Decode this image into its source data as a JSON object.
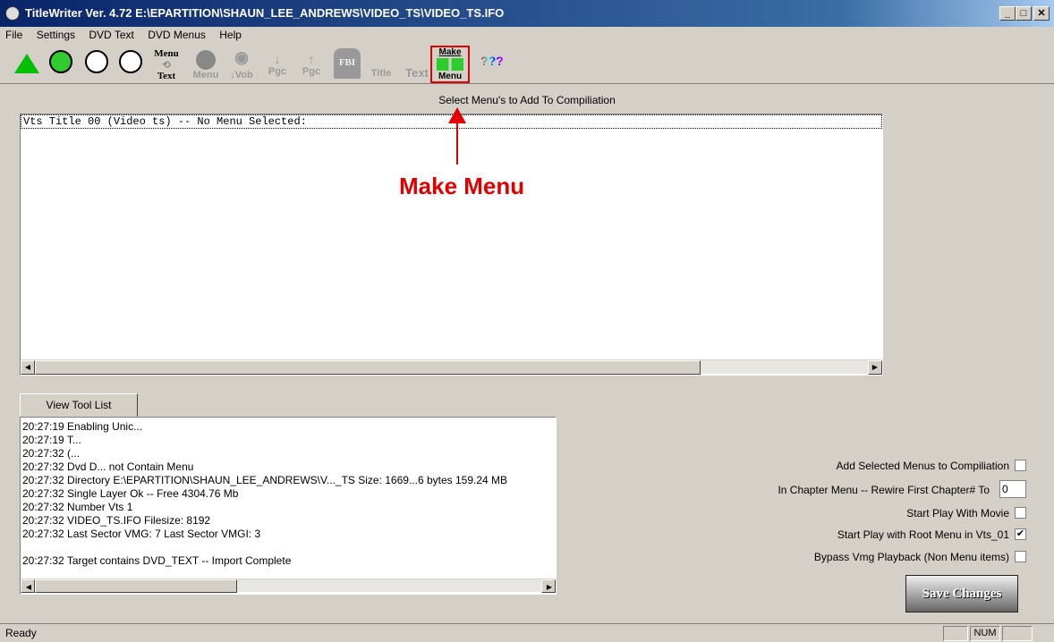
{
  "window": {
    "title": "TitleWriter Ver. 4.72  E:\\EPARTITION\\SHAUN_LEE_ANDREWS\\VIDEO_TS\\VIDEO_TS.IFO",
    "min": "_",
    "max": "□",
    "close": "✕"
  },
  "menu": [
    "File",
    "Settings",
    "DVD Text",
    "DVD Menus",
    "Help"
  ],
  "toolbar": {
    "menu_text_top": "Menu",
    "menu_text_bottom": "Text",
    "menu": "Menu",
    "vob": "↓Vob",
    "pgc_down": "Pgc",
    "pgc_up": "Pgc",
    "fbi": "FBI",
    "title": "Title",
    "text": "Text",
    "make": "Make",
    "make_menu": "Menu",
    "help": "???"
  },
  "main": {
    "list_label": "Select Menu's to Add To Compiliation",
    "list_items": [
      "Vts Title 00 (Video ts) -- No Menu Selected:"
    ]
  },
  "annotation": {
    "label": "Make Menu",
    "color": "#e00000"
  },
  "tool_tab": "View Tool List",
  "log": [
    "20:27:19 Enabling Unic...",
    "20:27:19 T...",
    "20:27:32 (...",
    "20:27:32 Dvd D... not Contain Menu",
    "20:27:32 Directory E:\\EPARTITION\\SHAUN_LEE_ANDREWS\\V..._TS Size: 1669...6 bytes  159.24 MB",
    "20:27:32 Single Layer Ok -- Free  4304.76 Mb",
    "20:27:32 Number Vts 1",
    "20:27:32 VIDEO_TS.IFO Filesize: 8192",
    "20:27:32 Last Sector VMG: 7   Last Sector VMGI: 3",
    "",
    "20:27:32 Target contains DVD_TEXT -- Import Complete"
  ],
  "options": {
    "add_selected": {
      "label": "Add Selected Menus to Compiliation",
      "checked": false
    },
    "rewire": {
      "label": "In Chapter Menu -- Rewire First Chapter#  To",
      "value": "0"
    },
    "start_movie": {
      "label": "Start Play With Movie",
      "checked": false
    },
    "start_root": {
      "label": "Start Play with Root Menu in Vts_01",
      "checked": true,
      "mark": "✔"
    },
    "bypass": {
      "label": "Bypass Vmg Playback (Non Menu items)",
      "checked": false
    }
  },
  "save": "Save Changes",
  "status": {
    "text": "Ready",
    "num": "NUM"
  }
}
